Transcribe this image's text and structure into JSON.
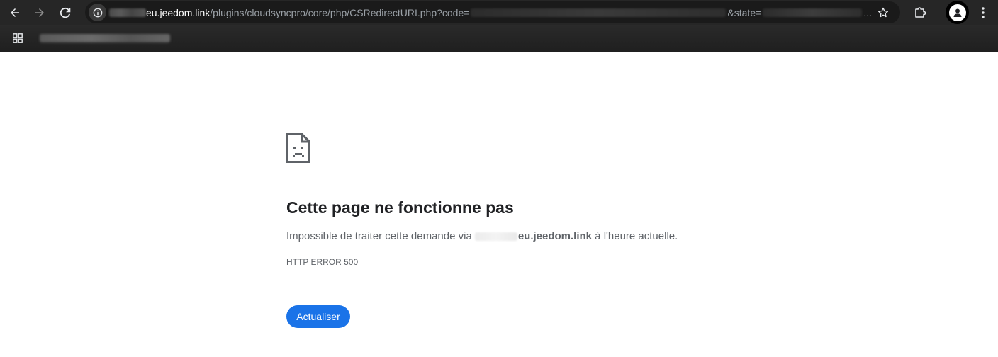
{
  "toolbar": {
    "url": {
      "host": "eu.jeedom.link",
      "path": "/plugins/cloudsyncpro/core/php/CSRedirectURI.php?code=",
      "state_param": "&state=",
      "ellipsis": "..."
    }
  },
  "error_page": {
    "title": "Cette page ne fonctionne pas",
    "description_prefix": "Impossible de traiter cette demande via ",
    "description_host": "eu.jeedom.link",
    "description_suffix": " à l'heure actuelle.",
    "error_code": "HTTP ERROR 500",
    "reload_label": "Actualiser"
  },
  "colors": {
    "chrome_background": "#262626",
    "omnibox_background": "#1a1a1a",
    "primary_button": "#1a73e8",
    "title_text": "#202124",
    "body_text": "#5f6368"
  },
  "icons": {
    "back": "back-arrow-icon",
    "forward": "forward-arrow-icon",
    "reload": "reload-icon",
    "site_info": "info-icon",
    "bookmark": "star-icon",
    "extensions": "puzzle-icon",
    "profile": "person-icon",
    "menu": "kebab-menu-icon",
    "apps": "apps-grid-icon",
    "error": "sad-document-icon"
  }
}
